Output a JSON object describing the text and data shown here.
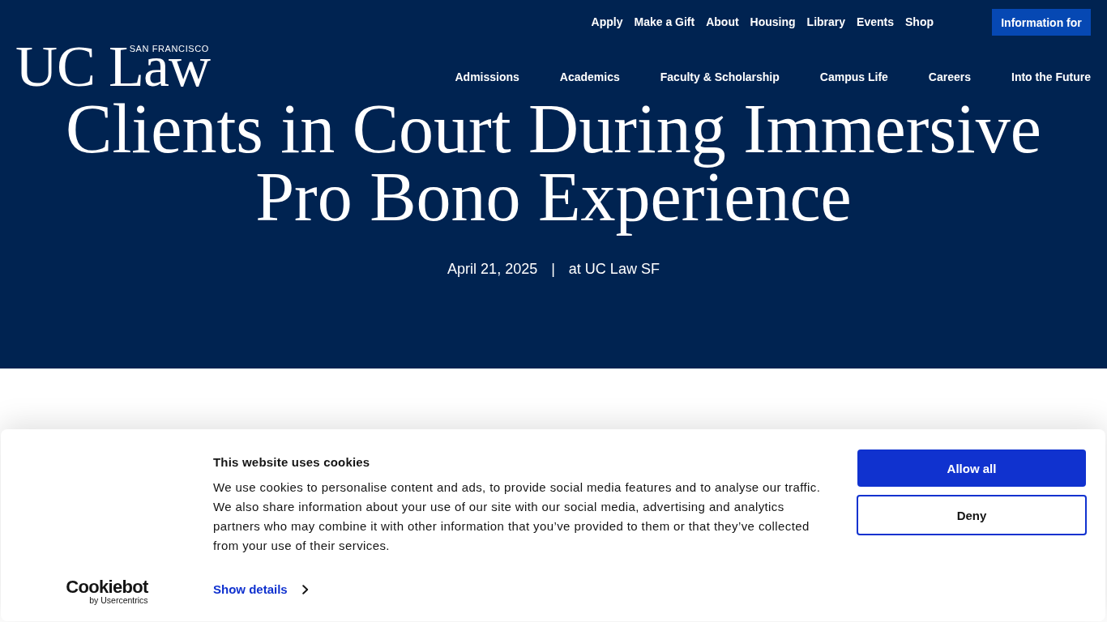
{
  "header": {
    "logo": {
      "wordmark": "UC Law",
      "tagline": "SAN FRANCISCO"
    },
    "utility_nav": [
      "Apply",
      "Make a Gift",
      "About",
      "Housing",
      "Library",
      "Events",
      "Shop"
    ],
    "info_button": "Information for",
    "main_nav": [
      "Admissions",
      "Academics",
      "Faculty & Scholarship",
      "Campus Life",
      "Careers",
      "Into the Future"
    ]
  },
  "article": {
    "title": "Clients in Court During Immersive Pro Bono Experience",
    "date": "April 21, 2025",
    "separator": "|",
    "location": "at UC Law SF"
  },
  "cookie_banner": {
    "brand": {
      "name": "Cookiebot",
      "byline": "by Usercentrics"
    },
    "title": "This website uses cookies",
    "body": "We use cookies to personalise content and ads, to provide social media features and to analyse our traffic. We also share information about your use of our site with our social media, advertising and analytics partners who may combine it with other information that you’ve provided to them or that they’ve collected from your use of their services.",
    "details_link": "Show details",
    "buttons": [
      {
        "label": "Allow all",
        "kind": "primary"
      },
      {
        "label": "Deny",
        "kind": "secondary"
      }
    ]
  }
}
